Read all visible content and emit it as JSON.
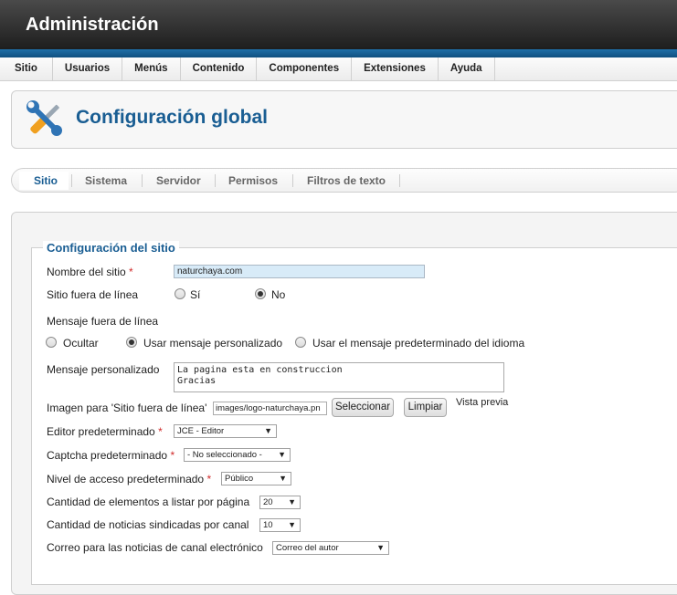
{
  "header": {
    "title": "Administración"
  },
  "menu": {
    "items": [
      "Sitio",
      "Usuarios",
      "Menús",
      "Contenido",
      "Componentes",
      "Extensiones",
      "Ayuda"
    ]
  },
  "page": {
    "title": "Configuración global",
    "icon": "tools-icon"
  },
  "tabs": {
    "items": [
      "Sitio",
      "Sistema",
      "Servidor",
      "Permisos",
      "Filtros de texto"
    ],
    "active": "Sitio"
  },
  "form": {
    "legend": "Configuración del sitio",
    "site_name": {
      "label": "Nombre del sitio",
      "required": "*",
      "value": "naturchaya.com"
    },
    "offline": {
      "label": "Sitio fuera de línea",
      "options": [
        "Sí",
        "No"
      ],
      "selected": "No"
    },
    "offline_message": {
      "label": "Mensaje fuera de línea",
      "options": [
        "Ocultar",
        "Usar mensaje personalizado",
        "Usar el mensaje predeterminado del idioma"
      ],
      "selected": "Usar mensaje personalizado"
    },
    "custom_message": {
      "label": "Mensaje personalizado",
      "value": "La pagina esta en construccion\nGracias"
    },
    "offline_image": {
      "label": "Imagen para 'Sitio fuera de línea'",
      "value": "images/logo-naturchaya.pn",
      "select_button": "Seleccionar",
      "clear_button": "Limpiar",
      "preview_label": "Vista previa"
    },
    "default_editor": {
      "label": "Editor predeterminado",
      "required": "*",
      "value": "JCE - Editor"
    },
    "default_captcha": {
      "label": "Captcha predeterminado",
      "required": "*",
      "value": "- No seleccionado -"
    },
    "default_access": {
      "label": "Nivel de acceso predeterminado",
      "required": "*",
      "value": "Público"
    },
    "list_limit": {
      "label": "Cantidad de elementos a listar por página",
      "value": "20"
    },
    "feed_limit": {
      "label": "Cantidad de noticias sindicadas por canal",
      "value": "10"
    },
    "feed_email": {
      "label": "Correo para las noticias de canal electrónico",
      "value": "Correo del autor"
    }
  },
  "colors": {
    "accent": "#1a5e93",
    "header_stripe": "#1f6fa8",
    "required": "#d02a2a",
    "input_bg": "#d8ebf8"
  }
}
